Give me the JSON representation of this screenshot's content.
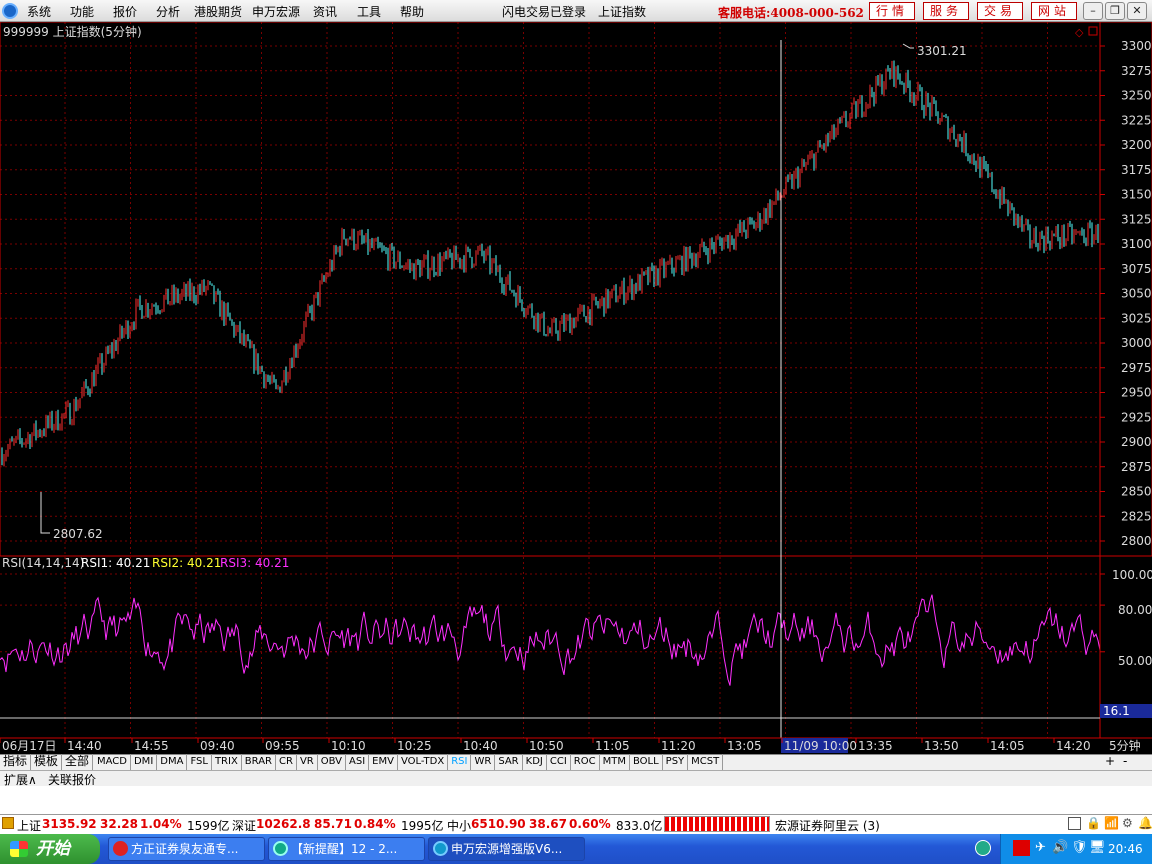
{
  "menu": {
    "items": [
      "系统",
      "功能",
      "报价",
      "分析",
      "港股期货",
      "申万宏源",
      "资讯",
      "工具",
      "帮助"
    ],
    "status1": "闪电交易已登录",
    "status2": "上证指数",
    "hotline": "客服电话:4008-000-562",
    "quick": [
      "行情",
      "服务",
      "交易",
      "网站"
    ],
    "win_min": "–",
    "win_restore": "❐",
    "win_close": "✕"
  },
  "chart": {
    "title": "999999 上证指数(5分钟)",
    "high_label": "3301.21",
    "low_label": "2807.62",
    "price_ticks": [
      "3300",
      "3275",
      "3250",
      "3225",
      "3200",
      "3175",
      "3150",
      "3125",
      "3100",
      "3075",
      "3050",
      "3025",
      "3000",
      "2975",
      "2950",
      "2925",
      "2900",
      "2875",
      "2850",
      "2825",
      "2800"
    ],
    "rsi_title": "RSI(14,14,14)",
    "rsi1": "RSI1: 40.21",
    "rsi2": "RSI2: 40.21",
    "rsi3": "RSI3: 40.21",
    "rsi_ticks": [
      "100.00",
      "80.00",
      "50.00"
    ],
    "rsi_cursor": "16.1",
    "time_labels": [
      "06月17日",
      "14:40",
      "14:55",
      "09:40",
      "09:55",
      "10:10",
      "10:25",
      "10:40",
      "10:50",
      "11:05",
      "11:20",
      "13:05",
      "11/09 10:00",
      "13:35",
      "13:50",
      "14:05",
      "14:20"
    ],
    "period": "5分钟",
    "colors": {
      "up": "#ff3030",
      "down": "#54ffff",
      "rsi": "#ff30ff",
      "grid": "#7a0000",
      "axis": "#cc0000"
    }
  },
  "chart_data": {
    "type": "line",
    "title": "999999 上证指数(5分钟)",
    "ylim": [
      2800,
      3300
    ],
    "x": [
      "06月17日",
      "14:40",
      "14:55",
      "09:40",
      "09:55",
      "10:10",
      "10:25",
      "10:40",
      "10:50",
      "11:05",
      "11:20",
      "13:05",
      "11/09 10:00",
      "13:35",
      "13:50",
      "14:05",
      "14:20"
    ],
    "series": [
      {
        "values": [
          2890,
          2930,
          3035,
          3055,
          2950,
          3110,
          3075,
          3090,
          3010,
          3050,
          3085,
          3120,
          3200,
          3275,
          3205,
          3105,
          3110
        ]
      }
    ],
    "high": 3301.21,
    "low": 2807.62
  },
  "indicator_tabs": [
    "MACD",
    "DMI",
    "DMA",
    "FSL",
    "TRIX",
    "BRAR",
    "CR",
    "VR",
    "OBV",
    "ASI",
    "EMV",
    "VOL-TDX",
    "RSI",
    "WR",
    "SAR",
    "KDJ",
    "CCI",
    "ROC",
    "MTM",
    "BOLL",
    "PSY",
    "MCST"
  ],
  "left_tabs": [
    "指标",
    "模板",
    "全部"
  ],
  "sub_tabs": [
    "扩展∧",
    "关联报价"
  ],
  "zoom_plus": "+",
  "zoom_minus": "-",
  "status": {
    "sh_name": "上证",
    "sh_val": "3135.92",
    "sh_chg": "32.28",
    "sh_pct": "1.04%",
    "sh_amt": "1599亿",
    "sz_name": "深证",
    "sz_val": "10262.8",
    "sz_chg": "85.71",
    "sz_pct": "0.84%",
    "sz_amt": "1995亿",
    "zx_name": "中小",
    "zx_val": "6510.90",
    "zx_chg": "38.67",
    "zx_pct": "0.60%",
    "zx_amt": "833.0亿",
    "server": "宏源证券阿里云 (3)"
  },
  "taskbar": {
    "start": "开始",
    "tasks": [
      "方正证券泉友通专...",
      "【新提醒】12 - 2...",
      "申万宏源增强版V6..."
    ],
    "time": "20:46"
  }
}
